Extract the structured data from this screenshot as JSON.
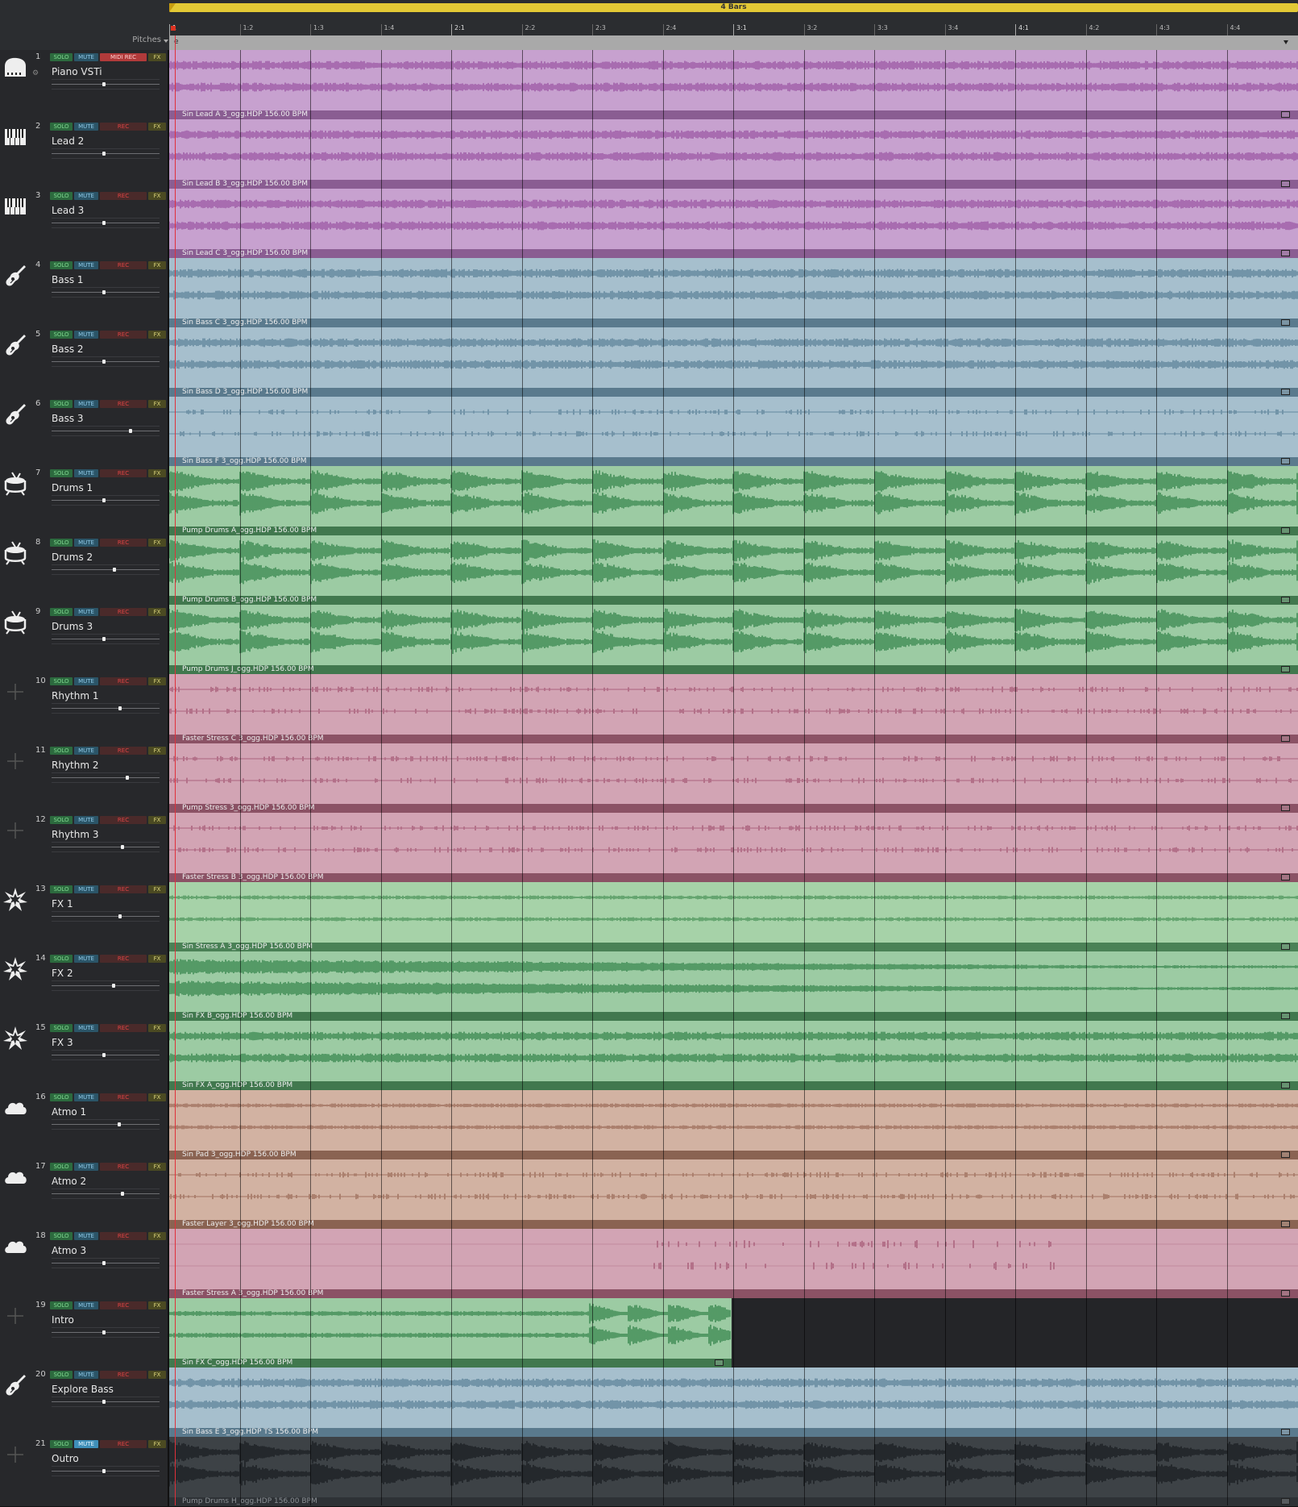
{
  "header": {
    "loop_label": "4 Bars",
    "pitches_label": "Pitches",
    "loop_marker": "e"
  },
  "ruler": [
    "1",
    "1:2",
    "1:3",
    "1:4",
    "2:1",
    "2:2",
    "2:3",
    "2:4",
    "3:1",
    "3:2",
    "3:3",
    "3:4",
    "4:1",
    "4:2",
    "4:3",
    "4:4"
  ],
  "buttons": {
    "solo": "SOLO",
    "mute": "MUTE",
    "rec": "REC",
    "midi_rec": "MIDI REC",
    "fx": "FX"
  },
  "tracks": [
    {
      "num": "1",
      "name": "Piano VSTi",
      "icon": "piano-icon",
      "rec": "MIDI REC",
      "vol": 0.47,
      "clip": "Sin Lead A 3_ogg.HDP  156.00 BPM",
      "color": "#c7a1cf",
      "wave": "#a466ad",
      "foot": "#8a5d92",
      "style": "dense"
    },
    {
      "num": "2",
      "name": "Lead 2",
      "icon": "keyboard-icon",
      "rec": "REC",
      "vol": 0.47,
      "clip": "Sin Lead B 3_ogg.HDP  156.00 BPM",
      "color": "#c7a1cf",
      "wave": "#a466ad",
      "foot": "#8a5d92",
      "style": "dense"
    },
    {
      "num": "3",
      "name": "Lead 3",
      "icon": "keyboard-icon",
      "rec": "REC",
      "vol": 0.47,
      "clip": "Sin Lead C 3_ogg.HDP  156.00 BPM",
      "color": "#c7a1cf",
      "wave": "#a466ad",
      "foot": "#8a5d92",
      "style": "dense"
    },
    {
      "num": "4",
      "name": "Bass 1",
      "icon": "guitar-icon",
      "rec": "REC",
      "vol": 0.47,
      "clip": "Sin Bass C 3_ogg.HDP  156.00 BPM",
      "color": "#a6bfcd",
      "wave": "#6c8fa4",
      "foot": "#5a7a8d",
      "style": "dense"
    },
    {
      "num": "5",
      "name": "Bass 2",
      "icon": "guitar-icon",
      "rec": "REC",
      "vol": 0.47,
      "clip": "Sin Bass D 3_ogg.HDP  156.00 BPM",
      "color": "#a6bfcd",
      "wave": "#6c8fa4",
      "foot": "#5a7a8d",
      "style": "dense"
    },
    {
      "num": "6",
      "name": "Bass 3",
      "icon": "guitar-icon",
      "rec": "REC",
      "vol": 0.72,
      "clip": "Sin Bass F 3_ogg.HDP  156.00 BPM",
      "color": "#a6bfcd",
      "wave": "#6c8fa4",
      "foot": "#5a7a8d",
      "style": "sparse"
    },
    {
      "num": "7",
      "name": "Drums 1",
      "icon": "drum-icon",
      "rec": "REC",
      "vol": 0.47,
      "clip": "Pump Drums A_ogg.HDP  156.00 BPM",
      "color": "#9ccba3",
      "wave": "#4d9460",
      "foot": "#41784e",
      "style": "drums"
    },
    {
      "num": "8",
      "name": "Drums 2",
      "icon": "drum-icon",
      "rec": "REC",
      "vol": 0.57,
      "clip": "Pump Drums B_ogg.HDP  156.00 BPM",
      "color": "#9ccba3",
      "wave": "#4d9460",
      "foot": "#41784e",
      "style": "drums"
    },
    {
      "num": "9",
      "name": "Drums 3",
      "icon": "drum-icon",
      "rec": "REC",
      "vol": 0.47,
      "clip": "Pump Drums J_ogg.HDP  156.00 BPM",
      "color": "#9ccba3",
      "wave": "#4d9460",
      "foot": "#41784e",
      "style": "drums"
    },
    {
      "num": "10",
      "name": "Rhythm 1",
      "icon": "empty-icon",
      "rec": "REC",
      "vol": 0.62,
      "clip": "Faster Stress C 3_ogg.HDP  156.00 BPM",
      "color": "#d2a4b4",
      "wave": "#b06a84",
      "foot": "#8b5265",
      "style": "sparse"
    },
    {
      "num": "11",
      "name": "Rhythm 2",
      "icon": "empty-icon",
      "rec": "REC",
      "vol": 0.69,
      "clip": "Pump Stress 3_ogg.HDP  156.00 BPM",
      "color": "#d2a4b4",
      "wave": "#b06a84",
      "foot": "#8b5265",
      "style": "sparse"
    },
    {
      "num": "12",
      "name": "Rhythm 3",
      "icon": "empty-icon",
      "rec": "REC",
      "vol": 0.64,
      "clip": "Faster Stress B 3_ogg.HDP  156.00 BPM",
      "color": "#d2a4b4",
      "wave": "#b06a84",
      "foot": "#8b5265",
      "style": "sparse"
    },
    {
      "num": "13",
      "name": "FX 1",
      "icon": "burst-icon",
      "rec": "REC",
      "vol": 0.62,
      "clip": "Sin Stress A 3_ogg.HDP  156.00 BPM",
      "color": "#a6d2a8",
      "wave": "#5ea06a",
      "foot": "#4a8156",
      "style": "thin"
    },
    {
      "num": "14",
      "name": "FX 2",
      "icon": "burst-icon",
      "rec": "REC",
      "vol": 0.56,
      "clip": "Sin FX B_ogg.HDP  156.00 BPM",
      "color": "#9ccba3",
      "wave": "#4d9460",
      "foot": "#41784e",
      "style": "fade"
    },
    {
      "num": "15",
      "name": "FX 3",
      "icon": "burst-icon",
      "rec": "REC",
      "vol": 0.47,
      "clip": "Sin FX A_ogg.HDP  156.00 BPM",
      "color": "#9ccba3",
      "wave": "#4d9460",
      "foot": "#41784e",
      "style": "dense"
    },
    {
      "num": "16",
      "name": "Atmo 1",
      "icon": "cloud-icon",
      "rec": "REC",
      "vol": 0.61,
      "clip": "Sin Pad 3_ogg.HDP  156.00 BPM",
      "color": "#d2b2a2",
      "wave": "#a77a68",
      "foot": "#8a6352",
      "style": "thin"
    },
    {
      "num": "17",
      "name": "Atmo 2",
      "icon": "cloud-icon",
      "rec": "REC",
      "vol": 0.64,
      "clip": "Faster Layer 3_ogg.HDP  156.00 BPM",
      "color": "#d2b2a2",
      "wave": "#a77a68",
      "foot": "#8a6352",
      "style": "sparse"
    },
    {
      "num": "18",
      "name": "Atmo 3",
      "icon": "cloud-icon",
      "rec": "REC",
      "vol": 0.47,
      "clip": "Faster Stress A 3_ogg.HDP  156.00 BPM",
      "color": "#d2a4b4",
      "wave": "#b06a84",
      "foot": "#8b5265",
      "style": "quiet"
    },
    {
      "num": "19",
      "name": "Intro",
      "icon": "empty-icon",
      "rec": "REC",
      "vol": 0.47,
      "clip": "Sin FX C_ogg.HDP  156.00 BPM",
      "color": "#9ccba3",
      "wave": "#4d9460",
      "foot": "#41784e",
      "style": "intro",
      "half": true
    },
    {
      "num": "20",
      "name": "Explore Bass",
      "icon": "guitar-icon",
      "rec": "REC",
      "vol": 0.47,
      "clip": "Sin Bass E 3_ogg.HDP  TS  156.00 BPM",
      "color": "#a6bfcd",
      "wave": "#6c8fa4",
      "foot": "#5a7a8d",
      "style": "dense"
    },
    {
      "num": "21",
      "name": "Outro",
      "icon": "empty-icon",
      "rec": "REC",
      "vol": 0.47,
      "mute_on": true,
      "clip": "Pump Drums H_ogg.HDP  156.00 BPM",
      "color": "#3d4246",
      "wave": "#22262a",
      "foot": "#2e3236",
      "style": "drums",
      "dark": true
    }
  ]
}
